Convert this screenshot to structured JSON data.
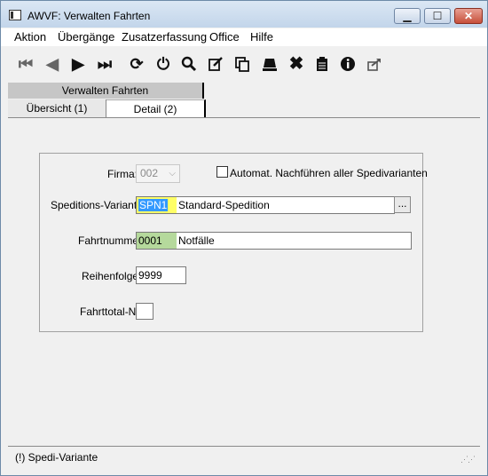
{
  "window": {
    "title": "AWVF: Verwalten Fahrten"
  },
  "menu": [
    "Aktion",
    "Übergänge",
    "Zusatzerfassung",
    "Office",
    "Hilfe"
  ],
  "toolbar": {
    "icons": [
      "skip-first-icon",
      "previous-icon",
      "next-icon",
      "skip-last-icon",
      "refresh-icon",
      "power-icon",
      "search-icon",
      "edit-icon",
      "copy-icon",
      "stamp-icon",
      "delete-icon",
      "clipboard-icon",
      "info-icon",
      "export-icon"
    ]
  },
  "tabs": {
    "top_label": "Verwalten Fahrten",
    "overview_label": "Übersicht (1)",
    "detail_label": "Detail (2)"
  },
  "form": {
    "firma_label": "Firma:",
    "firma_value": "002",
    "auto_label": "Automat. Nachführen aller Spedivarianten",
    "auto_checked": false,
    "spedition_label": "Speditions-Variante:",
    "spedition_code": "SPN1",
    "spedition_name": "Standard-Spedition",
    "ellipsis_label": "...",
    "fahrtnummer_label": "Fahrtnummer:",
    "fahrtnummer_code": "0001",
    "fahrtnummer_name": "Notfälle",
    "reihenfolge_label": "Reihenfolge:",
    "reihenfolge_value": "9999",
    "fahrttotal_label": "Fahrttotal-Nr:",
    "fahrttotal_value": ""
  },
  "status": {
    "text": "(!) Spedi-Variante"
  }
}
